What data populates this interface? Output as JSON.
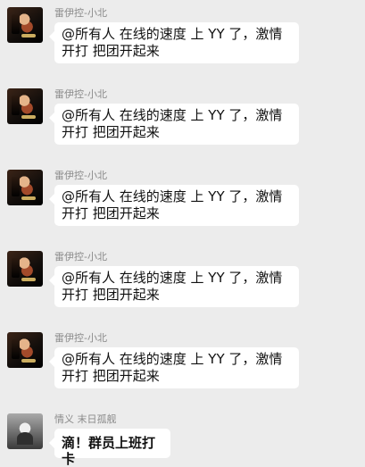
{
  "chat": {
    "messages": [
      {
        "sender": "雷伊控-小北",
        "text": "@所有人  在线的速度 上 YY 了，激情开打 把团开起来"
      },
      {
        "sender": "雷伊控-小北",
        "text": "@所有人  在线的速度 上 YY 了，激情开打 把团开起来"
      },
      {
        "sender": "雷伊控-小北",
        "text": "@所有人  在线的速度 上 YY 了，激情开打 把团开起来"
      },
      {
        "sender": "雷伊控-小北",
        "text": "@所有人  在线的速度 上 YY 了，激情开打 把团开起来"
      },
      {
        "sender": "雷伊控-小北",
        "text": "@所有人  在线的速度 上 YY 了，激情开打 把团开起来"
      },
      {
        "sender": "情义 末日孤舰",
        "text": "滴！群员上班打卡"
      }
    ],
    "colors": {
      "background": "#ececec",
      "bubble": "#ffffff",
      "nickname": "#8a8a8a"
    },
    "avatars": {
      "leiyi": "avatar-image",
      "beckham": "avatar-image"
    }
  }
}
